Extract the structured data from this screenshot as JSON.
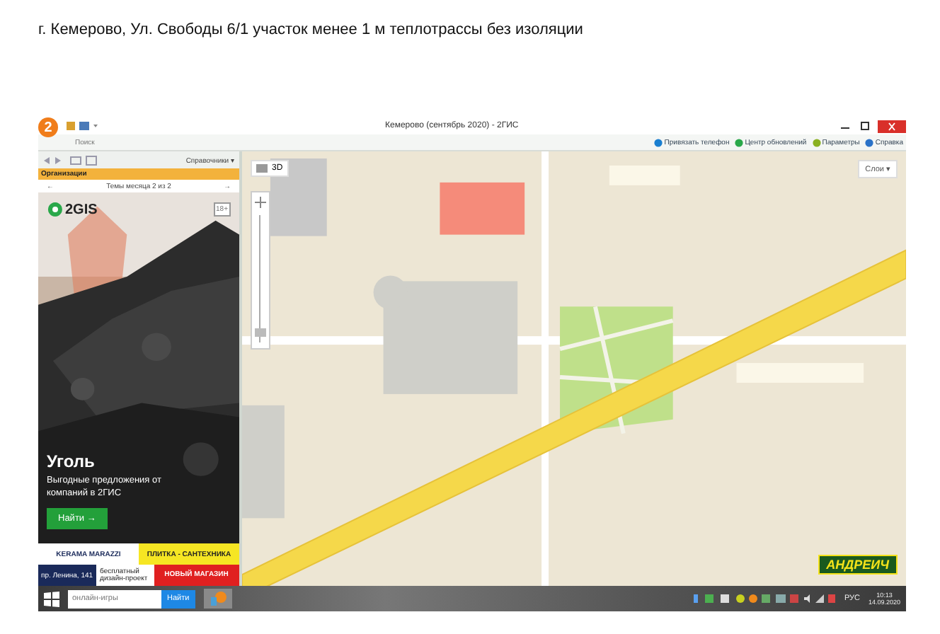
{
  "document_title": "г. Кемерово, Ул. Свободы 6/1 участок менее 1 м теплотрассы без изоляции",
  "window": {
    "app_logo": "2",
    "title": "Кемерово (сентябрь 2020) - 2ГИС",
    "search_tab": "Поиск",
    "toolbar_links": [
      {
        "label": "Привязать телефон",
        "kind": "phone"
      },
      {
        "label": "Центр обновлений",
        "kind": "update"
      },
      {
        "label": "Параметры",
        "kind": "settings"
      },
      {
        "label": "Справка",
        "kind": "help"
      }
    ]
  },
  "sidebar": {
    "directory_menu": "Справочники ▾",
    "section": "Организации",
    "pager": {
      "prev": "←",
      "label": "Темы месяца 2 из 2",
      "next": "→"
    },
    "ad": {
      "kind": "picture",
      "brand": "2GIS",
      "age": "18+",
      "title": "Уголь",
      "text": "Выгодные предложения от компаний в 2ГИС",
      "button": "Найти →"
    },
    "banner": {
      "brand": "KERAMA MARAZZI",
      "category": "ПЛИТКА - САНТЕХНИКА",
      "address": "пр. Ленина, 141",
      "offer": "бесплатный дизайн-проект",
      "promo": "НОВЫЙ МАГАЗИН"
    }
  },
  "map": {
    "kind": "picture",
    "view_mode": "3D",
    "zoom": {
      "level": 0.05
    },
    "layers_button": "Слои ▾",
    "ad_logo": "АНДРЕИЧ"
  },
  "taskbar": {
    "search_placeholder": "онлайн-игры",
    "search_button": "Найти",
    "language": "РУС",
    "time": "10:13",
    "date": "14.09.2020"
  }
}
